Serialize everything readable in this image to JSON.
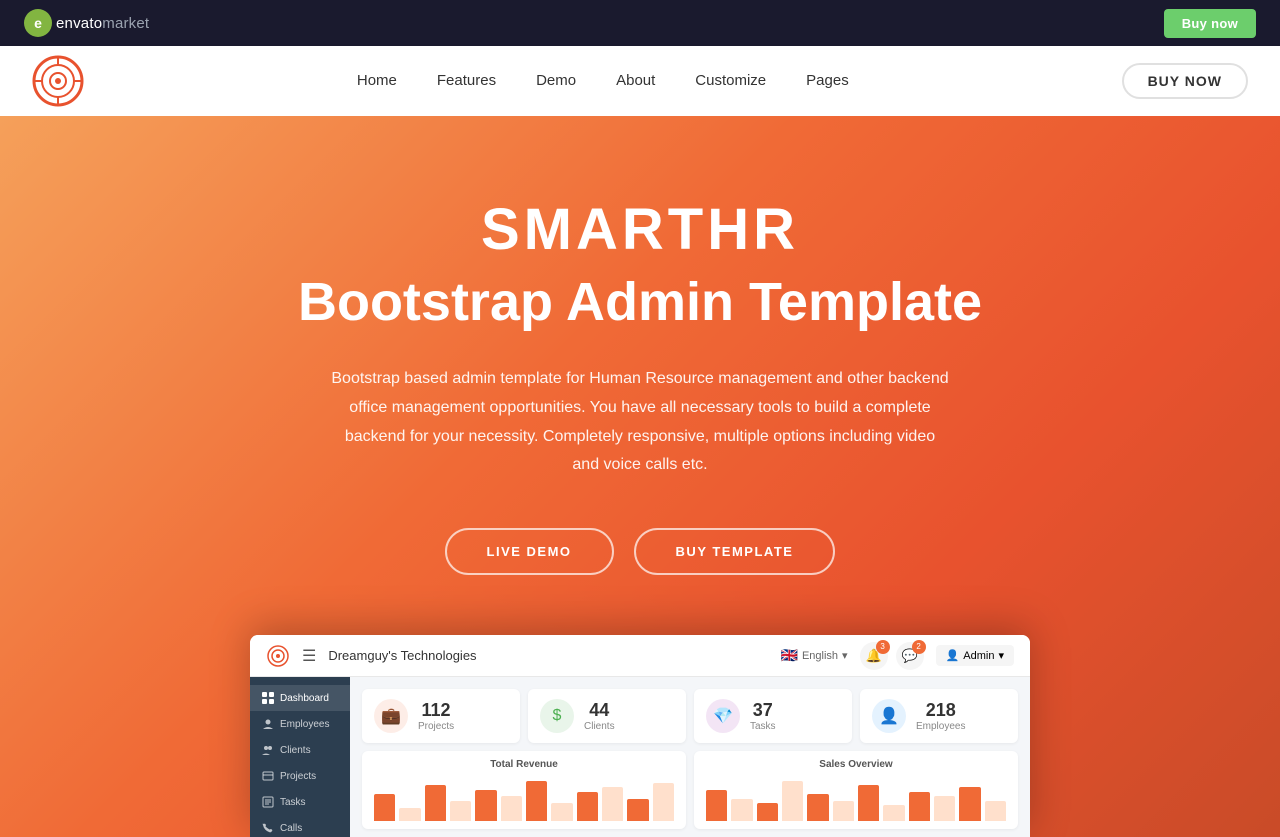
{
  "topbar": {
    "logo_text": "envato",
    "logo_market": "market",
    "buy_now_label": "Buy now"
  },
  "navbar": {
    "buy_now_label": "BUY NOW",
    "links": [
      {
        "id": "home",
        "label": "Home"
      },
      {
        "id": "features",
        "label": "Features"
      },
      {
        "id": "demo",
        "label": "Demo"
      },
      {
        "id": "about",
        "label": "About"
      },
      {
        "id": "customize",
        "label": "Customize"
      },
      {
        "id": "pages",
        "label": "Pages"
      }
    ]
  },
  "hero": {
    "title_main": "SMARTHR",
    "title_sub": "Bootstrap Admin Template",
    "description": "Bootstrap based admin template for Human Resource management and other backend office management opportunities. You have all necessary tools to build a complete backend for your necessity. Completely responsive, multiple options including video and voice calls etc.",
    "btn_live_demo": "LIVE DEMO",
    "btn_buy_template": "BUY TEMPLATE"
  },
  "dashboard": {
    "company_name": "Dreamguy's Technologies",
    "lang": "English",
    "admin_label": "Admin",
    "sidebar_items": [
      {
        "label": "Dashboard",
        "active": true
      },
      {
        "label": "Employees"
      },
      {
        "label": "Clients"
      },
      {
        "label": "Projects"
      },
      {
        "label": "Tasks"
      },
      {
        "label": "Calls"
      }
    ],
    "stats": [
      {
        "number": "112",
        "label": "Projects",
        "icon": "💼",
        "icon_class": "icon-orange"
      },
      {
        "number": "44",
        "label": "Clients",
        "icon": "$",
        "icon_class": "icon-green"
      },
      {
        "number": "37",
        "label": "Tasks",
        "icon": "💎",
        "icon_class": "icon-purple"
      },
      {
        "number": "218",
        "label": "Employees",
        "icon": "👤",
        "icon_class": "icon-blue"
      }
    ],
    "chart1_title": "Total Revenue",
    "chart2_title": "Sales Overview",
    "chart1_bars": [
      60,
      30,
      80,
      45,
      70,
      55,
      90,
      40,
      65,
      75,
      50,
      85
    ],
    "chart2_bars": [
      70,
      50,
      40,
      90,
      60,
      45,
      80,
      35,
      65,
      55,
      75,
      45
    ]
  }
}
